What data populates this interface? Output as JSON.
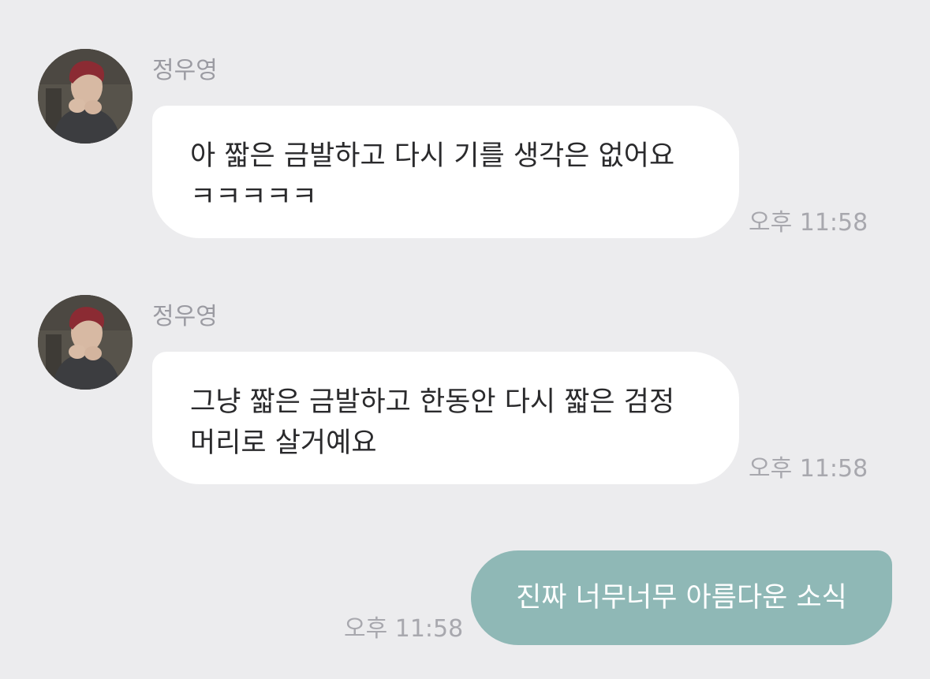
{
  "messages": [
    {
      "sender": "정우영",
      "text": "아 짧은 금발하고 다시 기를 생각은 없어요 ㅋㅋㅋㅋㅋ",
      "time": "오후 11:58"
    },
    {
      "sender": "정우영",
      "text": "그냥 짧은 금발하고 한동안 다시 짧은 검정 머리로 살거예요",
      "time": "오후 11:58"
    },
    {
      "text": "진짜 너무너무 아름다운 소식",
      "time": "오후 11:58"
    }
  ],
  "colors": {
    "background": "#ececee",
    "incoming_bubble": "#ffffff",
    "outgoing_bubble": "#8fb8b6",
    "meta_text": "#a8a8ae"
  }
}
